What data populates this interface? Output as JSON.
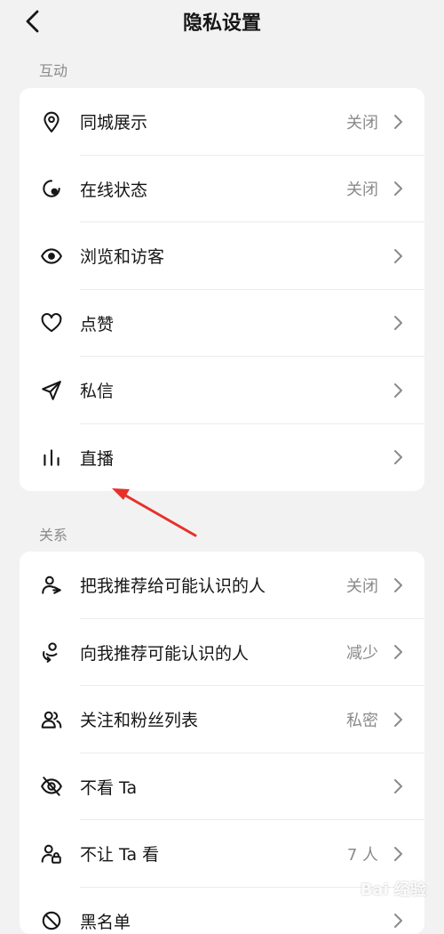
{
  "header": {
    "title": "隐私设置"
  },
  "sections": [
    {
      "label": "互动",
      "items": [
        {
          "label": "同城展示",
          "value": "关闭",
          "icon": "location-pin-icon"
        },
        {
          "label": "在线状态",
          "value": "关闭",
          "icon": "online-status-icon"
        },
        {
          "label": "浏览和访客",
          "value": "",
          "icon": "eye-icon"
        },
        {
          "label": "点赞",
          "value": "",
          "icon": "heart-icon"
        },
        {
          "label": "私信",
          "value": "",
          "icon": "send-icon"
        },
        {
          "label": "直播",
          "value": "",
          "icon": "bar-chart-icon"
        }
      ]
    },
    {
      "label": "关系",
      "items": [
        {
          "label": "把我推荐给可能认识的人",
          "value": "关闭",
          "icon": "user-share-icon"
        },
        {
          "label": "向我推荐可能认识的人",
          "value": "减少",
          "icon": "user-recommend-icon"
        },
        {
          "label": "关注和粉丝列表",
          "value": "私密",
          "icon": "users-icon"
        },
        {
          "label": "不看 Ta",
          "value": "",
          "icon": "eye-off-icon"
        },
        {
          "label": "不让 Ta 看",
          "value": "7 人",
          "icon": "user-lock-icon"
        },
        {
          "label": "黑名单",
          "value": "",
          "icon": "block-icon"
        }
      ]
    }
  ],
  "annotation": {
    "color": "#e8302a"
  },
  "watermark": {
    "text": "Bai 经验"
  }
}
